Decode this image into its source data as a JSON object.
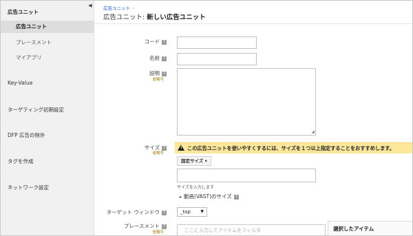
{
  "sidebar": {
    "collapse_glyph": "◀",
    "items": [
      {
        "label": "広告ユニット"
      },
      {
        "label": "広告ユニット"
      },
      {
        "label": "プレースメント"
      },
      {
        "label": "マイアプリ"
      },
      {
        "label": "Key-Value"
      },
      {
        "label": "ターゲティング初期設定"
      },
      {
        "label": "DFP 広告の除外"
      },
      {
        "label": "タグを作成"
      },
      {
        "label": "ネットワーク設定"
      }
    ]
  },
  "header": {
    "breadcrumb": "広告ユニット",
    "breadcrumb_sep": "›",
    "title_prefix": "広告ユニット:",
    "title_main": "新しい広告ユニット"
  },
  "form": {
    "help_glyph": "?",
    "code_label": "コード",
    "name_label": "名前",
    "desc_label": "説明",
    "optional_label": "省略可",
    "size_label": "サイズ",
    "size_optional": "省略可",
    "warning_text": "この広告ユニットを使いやすくするには、サイズを１つ以上指定することをおすすめします。",
    "warning_glyph": "!",
    "size_type": "固定サイズ",
    "size_type_caret": "▾",
    "size_hint": "サイズを入力します",
    "video_label": "動画(VAST)のサイズ",
    "video_arrow": "▸",
    "target_window_label": "ターゲット ウィンドウ",
    "target_window_value": "_top",
    "target_window_caret": "▼",
    "placement_label": "プレースメント",
    "placement_optional": "省略可",
    "filter_placeholder": "ここに入力してアイテムをフィルタ",
    "selected_items": "選択したアイテム"
  },
  "colors": {
    "link": "#1a56c8",
    "warning_bg": "#fce79a",
    "optional": "#a67400"
  }
}
